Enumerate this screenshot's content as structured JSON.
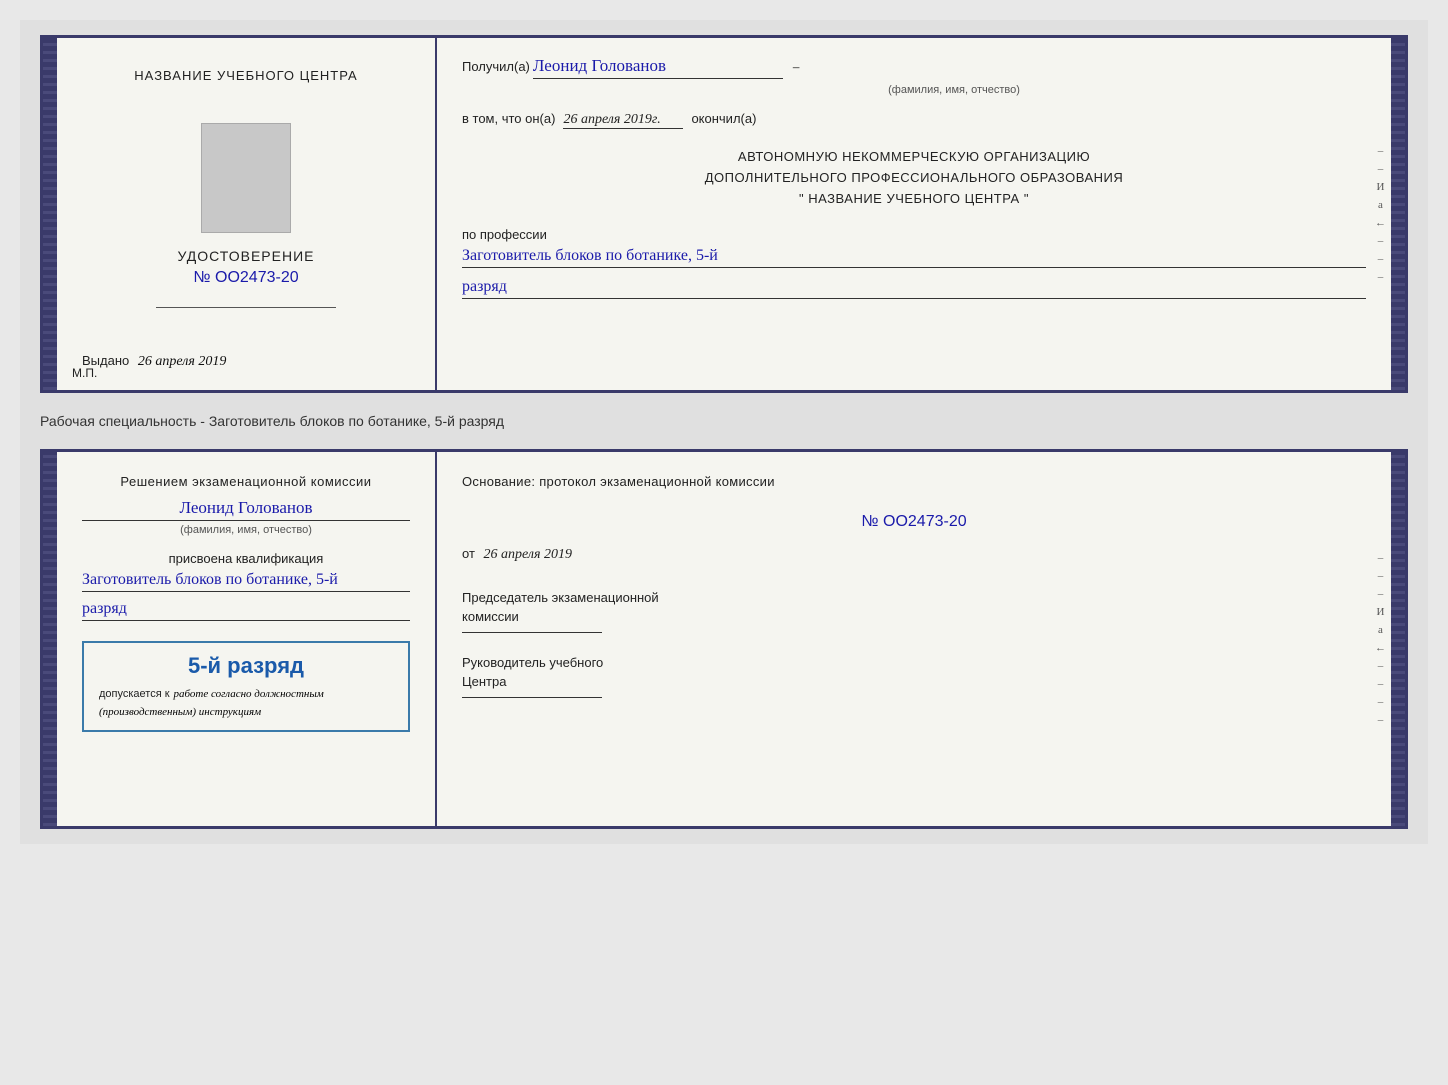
{
  "page": {
    "background": "#e0e0e0"
  },
  "cert_top": {
    "left": {
      "training_center_title": "НАЗВАНИЕ УЧЕБНОГО ЦЕНТРА",
      "cert_label": "УДОСТОВЕРЕНИЕ",
      "cert_number": "№ OO2473-20",
      "issued_label": "Выдано",
      "issued_date": "26 апреля 2019",
      "mp_label": "М.П."
    },
    "right": {
      "recipient_prefix": "Получил(а)",
      "recipient_name": "Леонид Голованов",
      "recipient_subtitle": "(фамилия, имя, отчество)",
      "vtom_prefix": "в том, что он(а)",
      "vtom_date": "26 апреля 2019г.",
      "vtom_suffix": "окончил(а)",
      "org_line1": "АВТОНОМНУЮ НЕКОММЕРЧЕСКУЮ ОРГАНИЗАЦИЮ",
      "org_line2": "ДОПОЛНИТЕЛЬНОГО ПРОФЕССИОНАЛЬНОГО ОБРАЗОВАНИЯ",
      "org_line3": "\"    НАЗВАНИЕ УЧЕБНОГО ЦЕНТРА    \"",
      "profession_label": "по профессии",
      "profession_name": "Заготовитель блоков по ботанике, 5-й",
      "rank_text": "разряд"
    }
  },
  "description": {
    "text": "Рабочая специальность - Заготовитель блоков по ботанике, 5-й разряд"
  },
  "cert_bottom": {
    "left": {
      "decision_text": "Решением  экзаменационной  комиссии",
      "name_handwritten": "Леонид Голованов",
      "fio_subtitle": "(фамилия, имя, отчество)",
      "qualification_label": "присвоена квалификация",
      "qualification_name": "Заготовитель блоков по ботанике, 5-й",
      "rank_text": "разряд",
      "stamp_rank": "5-й разряд",
      "stamp_allowed": "допускается к",
      "stamp_allowed_italic": "работе согласно должностным (производственным) инструкциям"
    },
    "right": {
      "osnov_label": "Основание: протокол экзаменационной  комиссии",
      "protocol_number": "№  OO2473-20",
      "from_prefix": "от",
      "from_date": "26 апреля 2019",
      "chair_label": "Председатель экзаменационной",
      "chair_label2": "комиссии",
      "center_leader_label": "Руководитель учебного",
      "center_leader_label2": "Центра"
    }
  },
  "side_chars": {
    "chars": [
      "И",
      "а",
      "←",
      "–",
      "–",
      "–",
      "–"
    ]
  }
}
